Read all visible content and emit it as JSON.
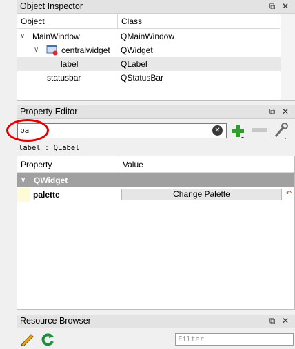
{
  "object_inspector": {
    "title": "Object Inspector",
    "columns": [
      "Object",
      "Class"
    ],
    "rows": [
      {
        "object": "MainWindow",
        "class": "QMainWindow"
      },
      {
        "object": "centralwidget",
        "class": "QWidget"
      },
      {
        "object": "label",
        "class": "QLabel"
      },
      {
        "object": "statusbar",
        "class": "QStatusBar"
      }
    ]
  },
  "property_editor": {
    "title": "Property Editor",
    "filter_value": "pa",
    "selected_object": "label : QLabel",
    "columns": [
      "Property",
      "Value"
    ],
    "group": "QWidget",
    "property_name": "palette",
    "property_value": "Change Palette"
  },
  "resource_browser": {
    "title": "Resource Browser",
    "filter_placeholder": "Filter"
  },
  "icons": {
    "float": "float-icon",
    "close": "close-icon",
    "expand": "chevron-down-icon",
    "clear": "clear-icon",
    "add": "add-icon",
    "remove": "remove-icon",
    "configure": "wrench-icon",
    "reset": "reset-icon",
    "edit": "pencil-icon",
    "reload": "reload-icon"
  },
  "colors": {
    "selection": "#e8e8e8",
    "group_header": "#a0a0a0",
    "property_cell": "#fffbd6",
    "highlight_circle": "#e00000"
  }
}
